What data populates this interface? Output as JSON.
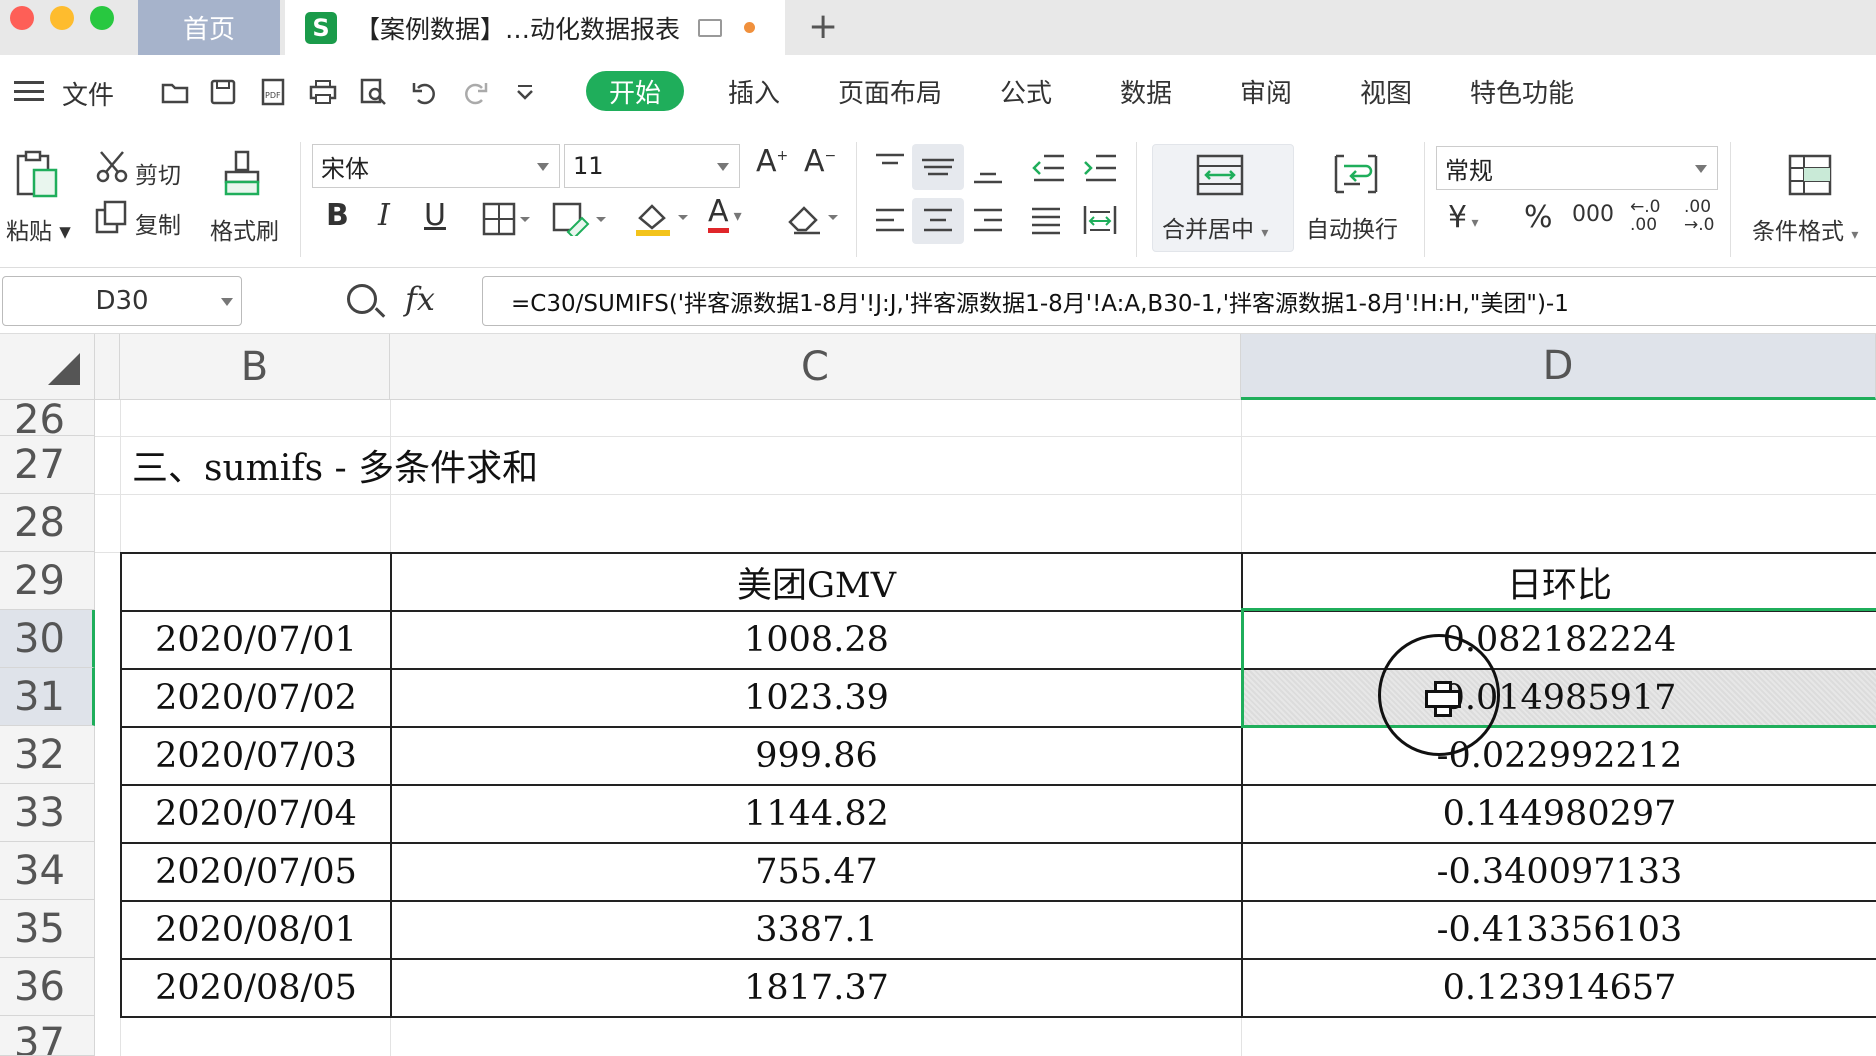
{
  "titlebar": {
    "home_tab": "首页",
    "doc_logo": "S",
    "doc_tab": "【案例数据】…动化数据报表",
    "add_tab": "+"
  },
  "menu": {
    "file": "文件",
    "start": "开始",
    "items": [
      "插入",
      "页面布局",
      "公式",
      "数据",
      "审阅",
      "视图",
      "特色功能"
    ]
  },
  "ribbon": {
    "paste": "粘贴",
    "cut": "剪切",
    "copy": "复制",
    "format_painter": "格式刷",
    "font_name": "宋体",
    "font_size": "11",
    "bold": "B",
    "italic": "I",
    "underline": "U",
    "font_color_glyph": "A",
    "grow_font": "A",
    "shrink_font": "A",
    "merge_center": "合并居中",
    "wrap_text": "自动换行",
    "number_format": "常规",
    "currency": "¥",
    "percent": "%",
    "thousands": "000",
    "inc_decimal": "←.0 .00",
    "dec_decimal": ".00 →.0",
    "conditional_format": "条件格式"
  },
  "formula_bar": {
    "name_box": "D30",
    "fx": "fx",
    "formula": "=C30/SUMIFS('拌客源数据1-8月'!J:J,'拌客源数据1-8月'!A:A,B30-1,'拌客源数据1-8月'!H:H,\"美团\")-1"
  },
  "grid": {
    "columns": [
      "B",
      "C",
      "D"
    ],
    "rows": [
      "26",
      "27",
      "28",
      "29",
      "30",
      "31",
      "32",
      "33",
      "34",
      "35",
      "36",
      "37"
    ],
    "section_title": "三、sumifs - 多条件求和",
    "header_gmv": "美团GMV",
    "header_ratio": "日环比",
    "data": [
      {
        "date": "2020/07/01",
        "gmv": "1008.28",
        "ratio": "0.082182224"
      },
      {
        "date": "2020/07/02",
        "gmv": "1023.39",
        "ratio": "0.014985917"
      },
      {
        "date": "2020/07/03",
        "gmv": "999.86",
        "ratio": "-0.022992212"
      },
      {
        "date": "2020/07/04",
        "gmv": "1144.82",
        "ratio": "0.144980297"
      },
      {
        "date": "2020/07/05",
        "gmv": "755.47",
        "ratio": "-0.340097133"
      },
      {
        "date": "2020/08/01",
        "gmv": "3387.1",
        "ratio": "-0.413356103"
      },
      {
        "date": "2020/08/05",
        "gmv": "1817.37",
        "ratio": "0.123914657"
      }
    ]
  },
  "colors": {
    "accent_green": "#1fae5b",
    "home_tab_bg": "#a6b3cb"
  }
}
